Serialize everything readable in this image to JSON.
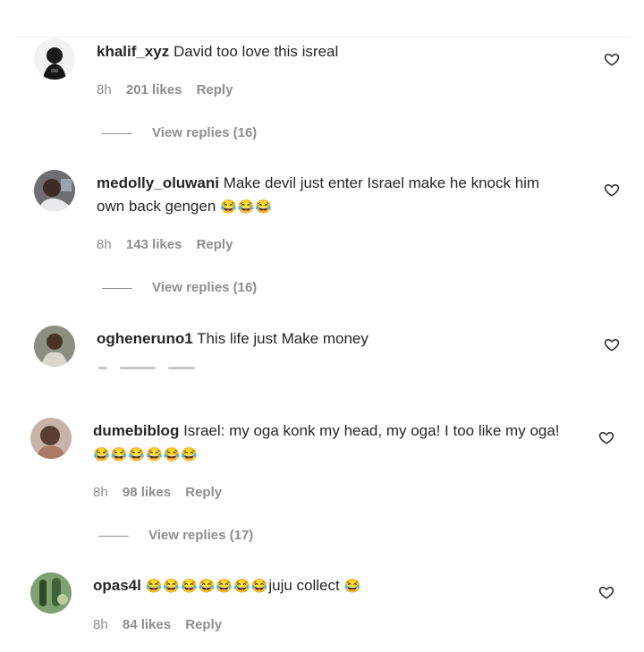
{
  "comments": [
    {
      "username": "khalif_xyz",
      "text": "David too love this isreal",
      "time": "8h",
      "likes": "201 likes",
      "reply": "Reply",
      "view_replies": "View replies (16)"
    },
    {
      "username": "medolly_oluwani",
      "text": "Make devil just enter Israel make he knock him own back gengen",
      "emoji": "😂😂😂",
      "time": "8h",
      "likes": "143 likes",
      "reply": "Reply",
      "view_replies": "View replies (16)"
    },
    {
      "username": "ogheneruno1",
      "text": "This life just Make money"
    },
    {
      "username": "dumebiblog",
      "text": "Israel: my oga konk my head, my oga! I too like my oga!",
      "emoji": "😂😂😂😂😂😂",
      "time": "8h",
      "likes": "98 likes",
      "reply": "Reply",
      "view_replies": "View replies (17)"
    },
    {
      "username": "opas4l",
      "emoji_lead": "😂😂😂😂😂😂😂",
      "text": "juju collect",
      "emoji": "😂",
      "time": "8h",
      "likes": "84 likes",
      "reply": "Reply"
    }
  ],
  "icons": {
    "like": "heart-icon",
    "emoji": "face-with-tears-of-joy"
  }
}
